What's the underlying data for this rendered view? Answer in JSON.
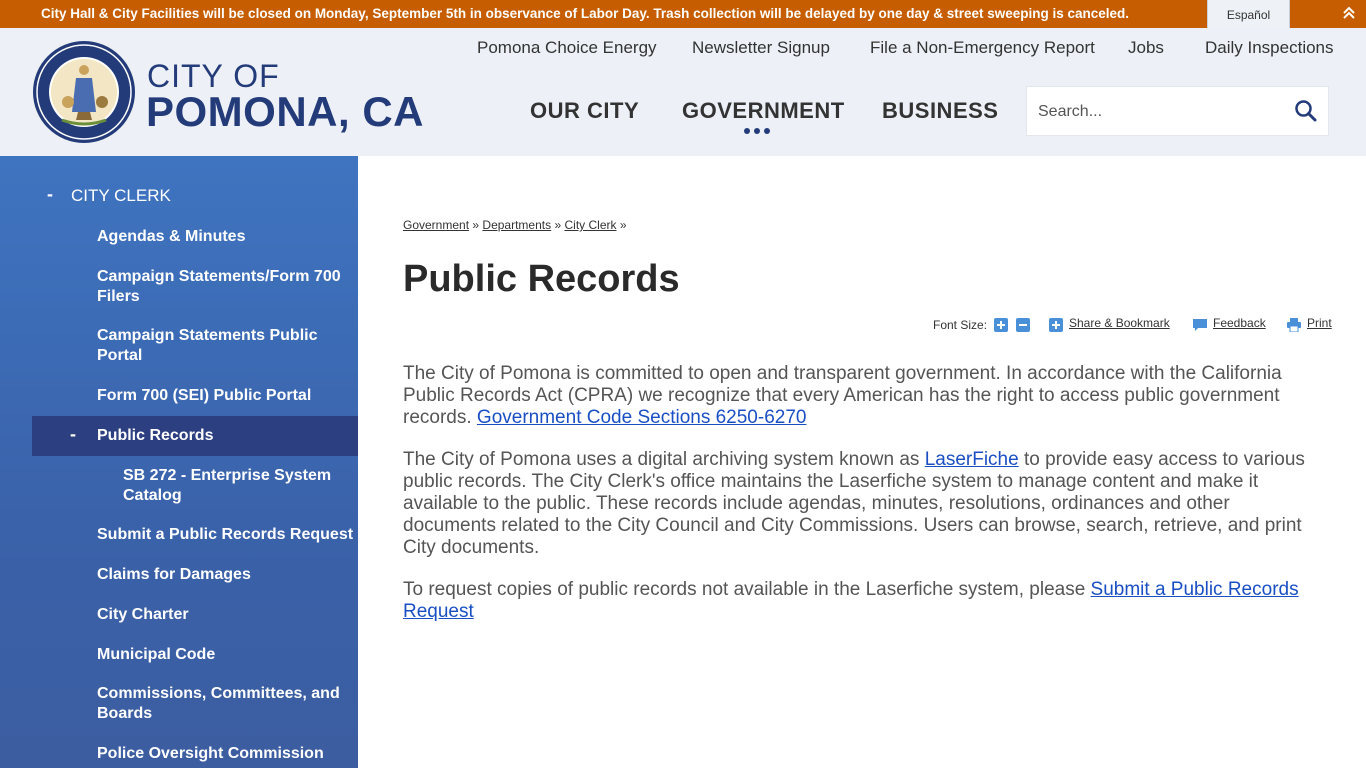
{
  "alert": {
    "text": "City Hall & City Facilities will be closed on Monday, September 5th in observance of Labor Day. Trash collection will be delayed by one day & street sweeping is canceled.",
    "language_button": "Español"
  },
  "header": {
    "city_of": "CITY OF",
    "city_name": "POMONA, CA",
    "utility_nav": [
      "Pomona Choice Energy",
      "Newsletter Signup",
      "File a Non-Emergency Report",
      "Jobs",
      "Daily Inspections"
    ],
    "main_nav": [
      "OUR CITY",
      "GOVERNMENT",
      "BUSINESS"
    ],
    "active_main_nav": "GOVERNMENT",
    "search_placeholder": "Search..."
  },
  "sidebar": {
    "parent": "CITY CLERK",
    "items": [
      "Agendas & Minutes",
      "Campaign Statements/Form 700 Filers",
      "Campaign Statements Public Portal",
      "Form 700 (SEI) Public Portal",
      "Public Records",
      "SB 272 - Enterprise System Catalog",
      "Submit a Public Records Request",
      "Claims for Damages",
      "City Charter",
      "Municipal Code",
      "Commissions, Committees, and Boards",
      "Police Oversight Commission"
    ],
    "active_item": "Public Records"
  },
  "breadcrumb": [
    "Government",
    "Departments",
    "City Clerk"
  ],
  "breadcrumb_separator": "»",
  "page_title": "Public Records",
  "tools": {
    "font_size_label": "Font Size:",
    "share": "Share & Bookmark",
    "feedback": "Feedback",
    "print": "Print"
  },
  "content": {
    "p1_text": "The City of Pomona is committed to open and transparent government.  In accordance with the California Public Records Act (CPRA) we recognize that every American has the right to access public government records.  ",
    "p1_link": "Government Code Sections 6250-6270",
    "p2_before": "The City of Pomona uses a digital archiving system known as ",
    "p2_link": "LaserFiche",
    "p2_after": " to provide easy access to various public records. The City Clerk's office maintains the Laserfiche system to manage content and make it available to the public. These records include agendas, minutes, resolutions, ordinances and other documents related to the City Council and City Commissions. Users can browse, search, retrieve, and print City documents.",
    "p3_text": "To request copies of public records not available in the Laserfiche system, please ",
    "p3_link": "Submit a Public Records Request"
  },
  "colors": {
    "alert_bg": "#c65d00",
    "header_bg": "#edf1f7",
    "brand_blue": "#243b7a",
    "sidebar_blue": "#3f74c0",
    "sidebar_active": "#2c3f80",
    "link_blue": "#1a4fc4"
  },
  "icons": [
    "collapse-up-icon",
    "search-icon",
    "font-increase-icon",
    "font-decrease-icon",
    "share-icon",
    "feedback-icon",
    "print-icon",
    "city-seal"
  ]
}
